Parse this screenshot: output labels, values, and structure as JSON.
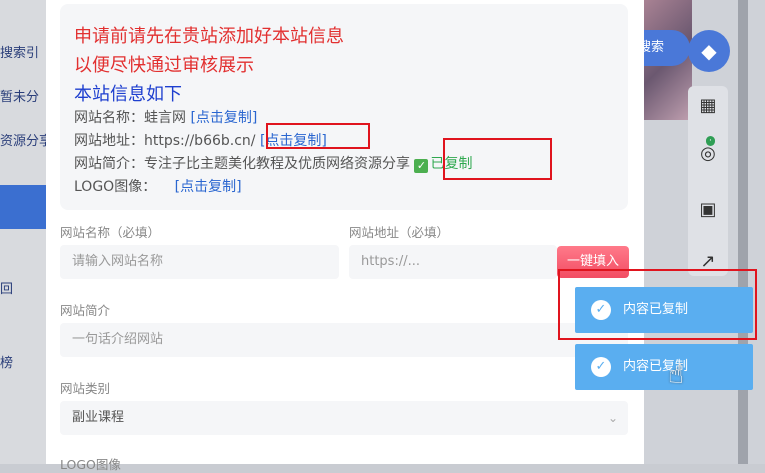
{
  "background": {
    "left_items": [
      "搜索引",
      "暂未分",
      "资源分享",
      "回",
      "榜"
    ],
    "search_label": "搜索"
  },
  "info": {
    "notice_line1": "申请前请先在贵站添加好本站信息",
    "notice_line2": "以便尽快通过审核展示",
    "heading": "本站信息如下",
    "rows": [
      {
        "label": "网站名称：",
        "value": "蛙言网",
        "copy": "[点击复制]"
      },
      {
        "label": "网站地址：",
        "value": "https://b66b.cn/",
        "copy": "[点击复制]"
      },
      {
        "label": "网站简介：",
        "value": "专注子比主题美化教程及优质网络资源分享",
        "copy": "已复制"
      },
      {
        "label": "LOGO图像：",
        "value": "",
        "copy": "[点击复制]"
      }
    ]
  },
  "form": {
    "site_name_label": "网站名称（必填）",
    "site_name_placeholder": "请输入网站名称",
    "site_url_label": "网站地址（必填）",
    "site_url_placeholder": "https://...",
    "fill_button": "一键填入",
    "intro_label": "网站简介",
    "intro_placeholder": "一句话介绍网站",
    "category_label": "网站类别",
    "category_value": "副业课程",
    "logo_label": "LOGO图像"
  },
  "toasts": [
    "内容已复制",
    "内容已复制"
  ],
  "colors": {
    "notice": "#e23030",
    "heading": "#1e3fcf",
    "link": "#2a66d0",
    "copied": "#2fa84f",
    "toast": "#5aaef0",
    "highlight": "#e0141e"
  }
}
